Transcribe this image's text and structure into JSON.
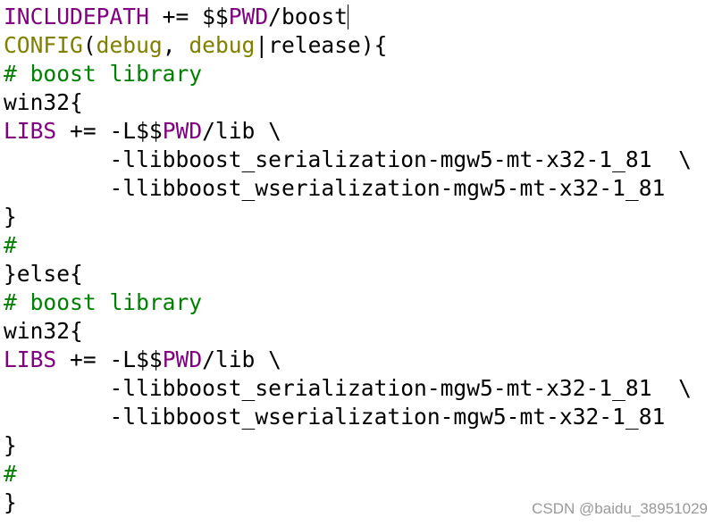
{
  "colors": {
    "plain": "#000000",
    "variable": "#800080",
    "function": "#808000",
    "comment": "#008000"
  },
  "lines": [
    [
      {
        "t": "INCLUDEPATH",
        "k": "var"
      },
      {
        "t": " += $$",
        "k": "plain"
      },
      {
        "t": "PWD",
        "k": "var"
      },
      {
        "t": "/boost",
        "k": "plain"
      }
    ],
    [
      {
        "t": "CONFIG",
        "k": "func"
      },
      {
        "t": "(",
        "k": "plain"
      },
      {
        "t": "debug",
        "k": "func"
      },
      {
        "t": ", ",
        "k": "plain"
      },
      {
        "t": "debug",
        "k": "func"
      },
      {
        "t": "|release){",
        "k": "plain"
      }
    ],
    [
      {
        "t": "# boost library",
        "k": "comment"
      }
    ],
    [
      {
        "t": "win32{",
        "k": "plain"
      }
    ],
    [
      {
        "t": "LIBS",
        "k": "var"
      },
      {
        "t": " += -L$$",
        "k": "plain"
      },
      {
        "t": "PWD",
        "k": "var"
      },
      {
        "t": "/lib \\",
        "k": "plain"
      }
    ],
    [
      {
        "t": "        -llibboost_serialization-mgw5-mt-x32-1_81  \\",
        "k": "plain"
      }
    ],
    [
      {
        "t": "        -llibboost_wserialization-mgw5-mt-x32-1_81",
        "k": "plain"
      }
    ],
    [
      {
        "t": "}",
        "k": "plain"
      }
    ],
    [
      {
        "t": "#",
        "k": "comment"
      }
    ],
    [
      {
        "t": "}else{",
        "k": "plain"
      }
    ],
    [
      {
        "t": "# boost library",
        "k": "comment"
      }
    ],
    [
      {
        "t": "win32{",
        "k": "plain"
      }
    ],
    [
      {
        "t": "LIBS",
        "k": "var"
      },
      {
        "t": " += -L$$",
        "k": "plain"
      },
      {
        "t": "PWD",
        "k": "var"
      },
      {
        "t": "/lib \\",
        "k": "plain"
      }
    ],
    [
      {
        "t": "        -llibboost_serialization-mgw5-mt-x32-1_81  \\",
        "k": "plain"
      }
    ],
    [
      {
        "t": "        -llibboost_wserialization-mgw5-mt-x32-1_81",
        "k": "plain"
      }
    ],
    [
      {
        "t": "}",
        "k": "plain"
      }
    ],
    [
      {
        "t": "#",
        "k": "comment"
      }
    ],
    [
      {
        "t": "}",
        "k": "plain"
      }
    ]
  ],
  "watermark": "CSDN @baidu_38951029"
}
